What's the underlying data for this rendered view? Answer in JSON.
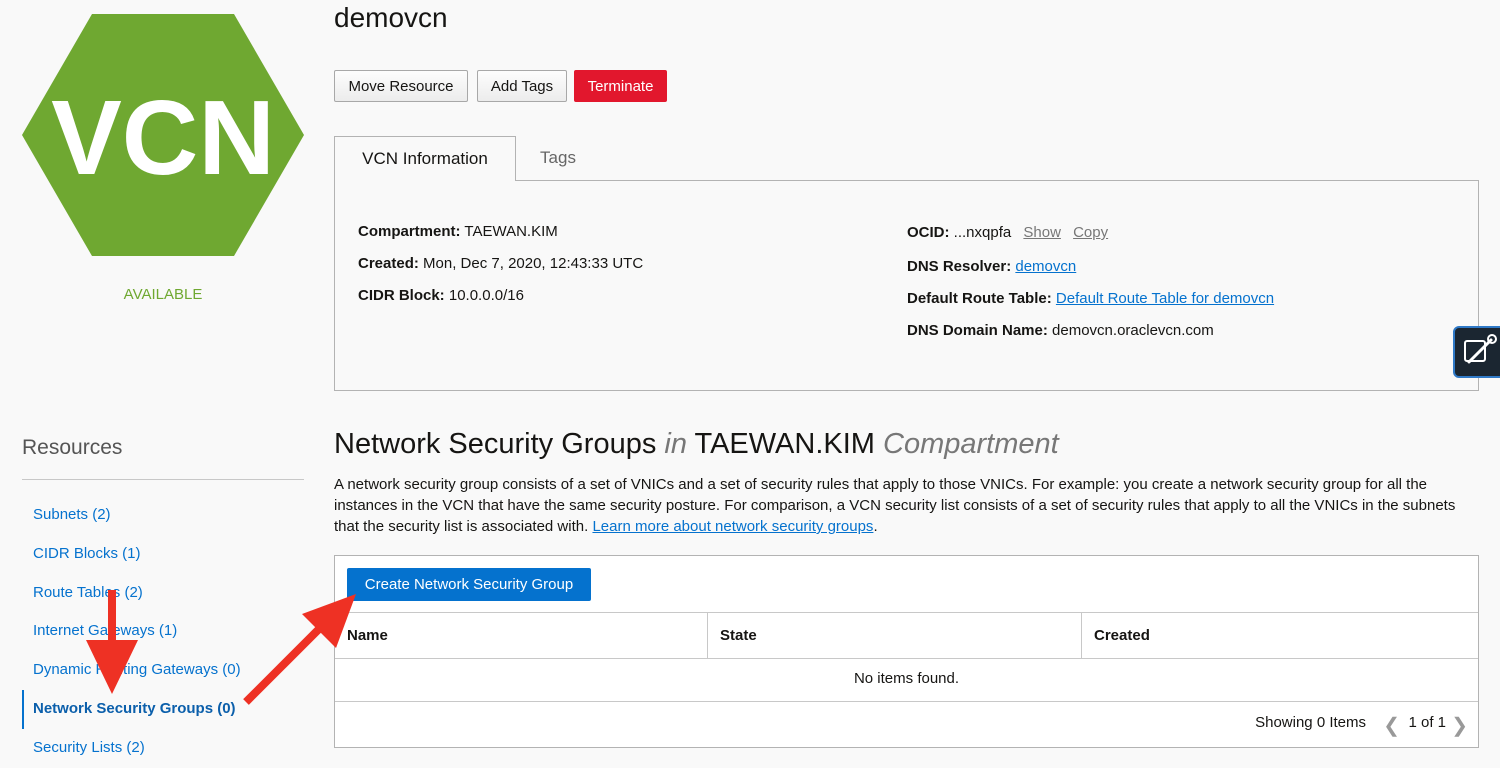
{
  "logo": {
    "text": "VCN",
    "color": "#6fa831"
  },
  "status": "AVAILABLE",
  "header": {
    "title": "demovcn",
    "buttons": {
      "move": "Move Resource",
      "tags": "Add Tags",
      "terminate": "Terminate"
    }
  },
  "tabs": {
    "info": "VCN Information",
    "tags": "Tags"
  },
  "info": {
    "compartment_label": "Compartment:",
    "compartment": "TAEWAN.KIM",
    "created_label": "Created:",
    "created": "Mon, Dec 7, 2020, 12:43:33 UTC",
    "cidr_label": "CIDR Block:",
    "cidr": "10.0.0.0/16",
    "ocid_label": "OCID:",
    "ocid": "...nxqpfa",
    "show": "Show",
    "copy": "Copy",
    "dns_resolver_label": "DNS Resolver:",
    "dns_resolver": "demovcn",
    "route_table_label": "Default Route Table:",
    "route_table": "Default Route Table for demovcn",
    "dns_domain_label": "DNS Domain Name:",
    "dns_domain": "demovcn.oraclevcn.com"
  },
  "resources": {
    "title": "Resources",
    "items": [
      "Subnets (2)",
      "CIDR Blocks (1)",
      "Route Tables (2)",
      "Internet Gateways (1)",
      "Dynamic Routing Gateways (0)",
      "Network Security Groups (0)",
      "Security Lists (2)"
    ]
  },
  "section": {
    "title_main": "Network Security Groups",
    "title_in": "in",
    "title_compartment": "TAEWAN.KIM",
    "title_suffix": "Compartment",
    "description": "A network security group consists of a set of VNICs and a set of security rules that apply to those VNICs. For example: you create a network security group for all the instances in the VCN that have the same security posture. For comparison, a VCN security list consists of a set of security rules that apply to all the VNICs in the subnets that the security list is associated with.",
    "learn_more": "Learn more about network security groups"
  },
  "table": {
    "create_button": "Create Network Security Group",
    "columns": [
      "Name",
      "State",
      "Created"
    ],
    "empty": "No items found.",
    "showing": "Showing 0 Items",
    "page": "1 of 1"
  },
  "colors": {
    "accent": "#0572ce",
    "danger": "#e2172d",
    "annotation": "#ee3124"
  }
}
